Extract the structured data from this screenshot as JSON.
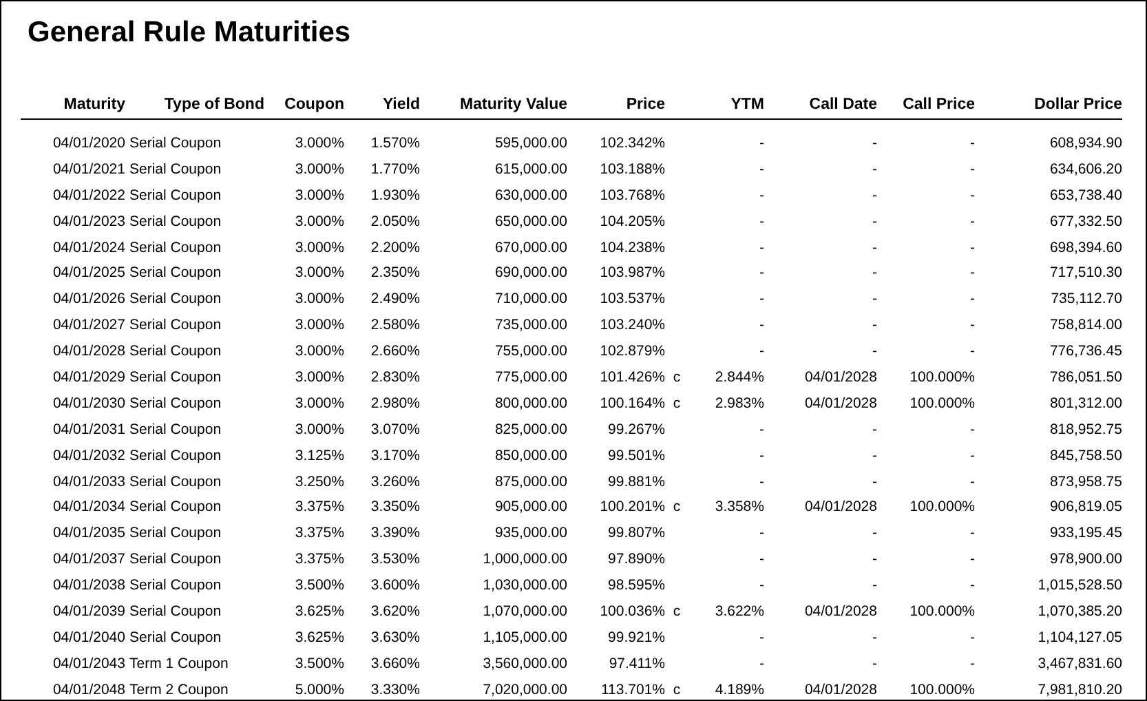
{
  "title": "General Rule Maturities",
  "table": {
    "columns": [
      "Maturity",
      "Type of Bond",
      "Coupon",
      "Yield",
      "Maturity Value",
      "Price",
      null,
      "YTM",
      "Call Date",
      "Call Price",
      "Dollar Price"
    ],
    "rows": [
      {
        "maturity": "04/01/2020",
        "type": "Serial Coupon",
        "coupon": "3.000%",
        "yield": "1.570%",
        "maturity_value": "595,000.00",
        "price": "102.342%",
        "ytm": "-",
        "call_date": "-",
        "call_price": "-",
        "dollar_price": "608,934.90"
      },
      {
        "maturity": "04/01/2021",
        "type": "Serial Coupon",
        "coupon": "3.000%",
        "yield": "1.770%",
        "maturity_value": "615,000.00",
        "price": "103.188%",
        "ytm": "-",
        "call_date": "-",
        "call_price": "-",
        "dollar_price": "634,606.20"
      },
      {
        "maturity": "04/01/2022",
        "type": "Serial Coupon",
        "coupon": "3.000%",
        "yield": "1.930%",
        "maturity_value": "630,000.00",
        "price": "103.768%",
        "ytm": "-",
        "call_date": "-",
        "call_price": "-",
        "dollar_price": "653,738.40"
      },
      {
        "maturity": "04/01/2023",
        "type": "Serial Coupon",
        "coupon": "3.000%",
        "yield": "2.050%",
        "maturity_value": "650,000.00",
        "price": "104.205%",
        "ytm": "-",
        "call_date": "-",
        "call_price": "-",
        "dollar_price": "677,332.50"
      },
      {
        "maturity": "04/01/2024",
        "type": "Serial Coupon",
        "coupon": "3.000%",
        "yield": "2.200%",
        "maturity_value": "670,000.00",
        "price": "104.238%",
        "ytm": "-",
        "call_date": "-",
        "call_price": "-",
        "dollar_price": "698,394.60"
      },
      {
        "maturity": "04/01/2025",
        "type": "Serial Coupon",
        "coupon": "3.000%",
        "yield": "2.350%",
        "maturity_value": "690,000.00",
        "price": "103.987%",
        "ytm": "-",
        "call_date": "-",
        "call_price": "-",
        "dollar_price": "717,510.30"
      },
      {
        "maturity": "04/01/2026",
        "type": "Serial Coupon",
        "coupon": "3.000%",
        "yield": "2.490%",
        "maturity_value": "710,000.00",
        "price": "103.537%",
        "ytm": "-",
        "call_date": "-",
        "call_price": "-",
        "dollar_price": "735,112.70"
      },
      {
        "maturity": "04/01/2027",
        "type": "Serial Coupon",
        "coupon": "3.000%",
        "yield": "2.580%",
        "maturity_value": "735,000.00",
        "price": "103.240%",
        "ytm": "-",
        "call_date": "-",
        "call_price": "-",
        "dollar_price": "758,814.00"
      },
      {
        "maturity": "04/01/2028",
        "type": "Serial Coupon",
        "coupon": "3.000%",
        "yield": "2.660%",
        "maturity_value": "755,000.00",
        "price": "102.879%",
        "ytm": "-",
        "call_date": "-",
        "call_price": "-",
        "dollar_price": "776,736.45"
      },
      {
        "maturity": "04/01/2029",
        "type": "Serial Coupon",
        "coupon": "3.000%",
        "yield": "2.830%",
        "maturity_value": "775,000.00",
        "price": "101.426%",
        "flag": "c",
        "ytm": "2.844%",
        "call_date": "04/01/2028",
        "call_price": "100.000%",
        "dollar_price": "786,051.50"
      },
      {
        "maturity": "04/01/2030",
        "type": "Serial Coupon",
        "coupon": "3.000%",
        "yield": "2.980%",
        "maturity_value": "800,000.00",
        "price": "100.164%",
        "flag": "c",
        "ytm": "2.983%",
        "call_date": "04/01/2028",
        "call_price": "100.000%",
        "dollar_price": "801,312.00"
      },
      {
        "maturity": "04/01/2031",
        "type": "Serial Coupon",
        "coupon": "3.000%",
        "yield": "3.070%",
        "maturity_value": "825,000.00",
        "price": "99.267%",
        "ytm": "-",
        "call_date": "-",
        "call_price": "-",
        "dollar_price": "818,952.75"
      },
      {
        "maturity": "04/01/2032",
        "type": "Serial Coupon",
        "coupon": "3.125%",
        "yield": "3.170%",
        "maturity_value": "850,000.00",
        "price": "99.501%",
        "ytm": "-",
        "call_date": "-",
        "call_price": "-",
        "dollar_price": "845,758.50"
      },
      {
        "maturity": "04/01/2033",
        "type": "Serial Coupon",
        "coupon": "3.250%",
        "yield": "3.260%",
        "maturity_value": "875,000.00",
        "price": "99.881%",
        "ytm": "-",
        "call_date": "-",
        "call_price": "-",
        "dollar_price": "873,958.75"
      },
      {
        "maturity": "04/01/2034",
        "type": "Serial Coupon",
        "coupon": "3.375%",
        "yield": "3.350%",
        "maturity_value": "905,000.00",
        "price": "100.201%",
        "flag": "c",
        "ytm": "3.358%",
        "call_date": "04/01/2028",
        "call_price": "100.000%",
        "dollar_price": "906,819.05"
      },
      {
        "maturity": "04/01/2035",
        "type": "Serial Coupon",
        "coupon": "3.375%",
        "yield": "3.390%",
        "maturity_value": "935,000.00",
        "price": "99.807%",
        "ytm": "-",
        "call_date": "-",
        "call_price": "-",
        "dollar_price": "933,195.45"
      },
      {
        "maturity": "04/01/2037",
        "type": "Serial Coupon",
        "coupon": "3.375%",
        "yield": "3.530%",
        "maturity_value": "1,000,000.00",
        "price": "97.890%",
        "ytm": "-",
        "call_date": "-",
        "call_price": "-",
        "dollar_price": "978,900.00"
      },
      {
        "maturity": "04/01/2038",
        "type": "Serial Coupon",
        "coupon": "3.500%",
        "yield": "3.600%",
        "maturity_value": "1,030,000.00",
        "price": "98.595%",
        "ytm": "-",
        "call_date": "-",
        "call_price": "-",
        "dollar_price": "1,015,528.50"
      },
      {
        "maturity": "04/01/2039",
        "type": "Serial Coupon",
        "coupon": "3.625%",
        "yield": "3.620%",
        "maturity_value": "1,070,000.00",
        "price": "100.036%",
        "flag": "c",
        "ytm": "3.622%",
        "call_date": "04/01/2028",
        "call_price": "100.000%",
        "dollar_price": "1,070,385.20"
      },
      {
        "maturity": "04/01/2040",
        "type": "Serial Coupon",
        "coupon": "3.625%",
        "yield": "3.630%",
        "maturity_value": "1,105,000.00",
        "price": "99.921%",
        "ytm": "-",
        "call_date": "-",
        "call_price": "-",
        "dollar_price": "1,104,127.05"
      },
      {
        "maturity": "04/01/2043",
        "type": "Term 1 Coupon",
        "coupon": "3.500%",
        "yield": "3.660%",
        "maturity_value": "3,560,000.00",
        "price": "97.411%",
        "ytm": "-",
        "call_date": "-",
        "call_price": "-",
        "dollar_price": "3,467,831.60"
      },
      {
        "maturity": "04/01/2048",
        "type": "Term 2 Coupon",
        "coupon": "5.000%",
        "yield": "3.330%",
        "maturity_value": "7,020,000.00",
        "price": "113.701%",
        "flag": "c",
        "ytm": "4.189%",
        "call_date": "04/01/2028",
        "call_price": "100.000%",
        "dollar_price": "7,981,810.20"
      }
    ]
  }
}
